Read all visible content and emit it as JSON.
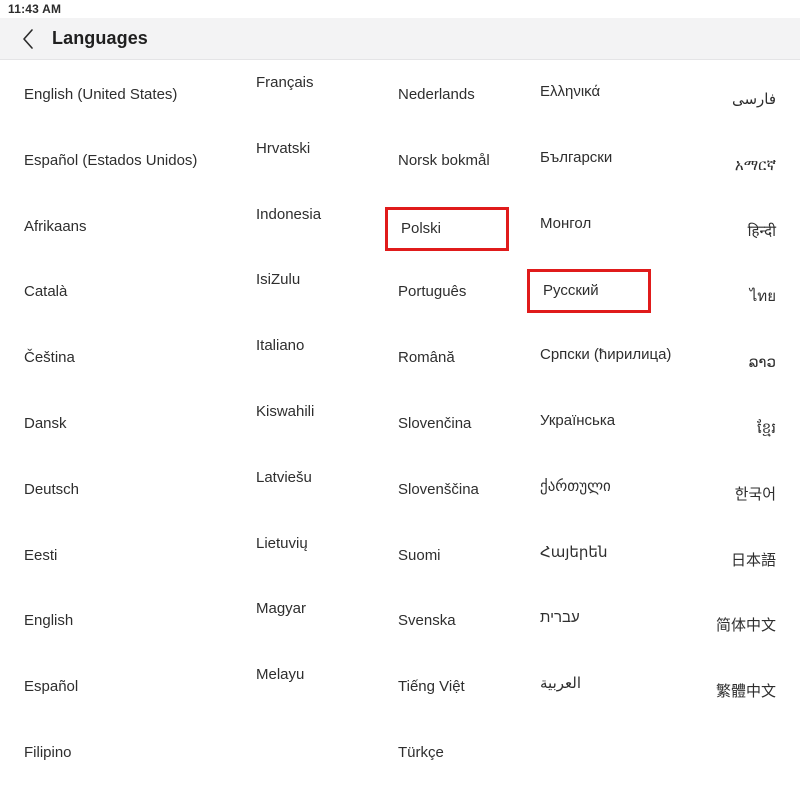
{
  "status_bar": {
    "time": "11:43 AM"
  },
  "app_bar": {
    "back_icon": "chevron-left-icon",
    "title": "Languages"
  },
  "highlight": {
    "color": "#e01b1b",
    "items": [
      "Polski",
      "Русский"
    ]
  },
  "language_grid": {
    "columns": [
      {
        "id": "column-1",
        "items": [
          "English (United States)",
          "Español (Estados Unidos)",
          "Afrikaans",
          "Català",
          "Čeština",
          "Dansk",
          "Deutsch",
          "Eesti",
          "English",
          "Español",
          "Filipino"
        ]
      },
      {
        "id": "column-2",
        "items": [
          "Français",
          "Hrvatski",
          "Indonesia",
          "IsiZulu",
          "Italiano",
          "Kiswahili",
          "Latviešu",
          "Lietuvių",
          "Magyar",
          "Melayu"
        ]
      },
      {
        "id": "column-3",
        "items": [
          "Nederlands",
          "Norsk bokmål",
          "Polski",
          "Português",
          "Română",
          "Slovenčina",
          "Slovenščina",
          "Suomi",
          "Svenska",
          "Tiếng Việt",
          "Türkçe"
        ]
      },
      {
        "id": "column-4",
        "items": [
          "Ελληνικά",
          "Български",
          "Монгол",
          "Русский",
          "Српски (ћирилица)",
          "Українська",
          "ქართული",
          "Հայերեն",
          "עברית",
          "العربية"
        ]
      },
      {
        "id": "column-5",
        "items": [
          "فارسی",
          "አማርኛ",
          "हिन्दी",
          "ไทย",
          "ລາວ",
          "ខ្មែរ",
          "한국어",
          "日本語",
          "简体中文",
          "繁體中文"
        ]
      }
    ]
  }
}
